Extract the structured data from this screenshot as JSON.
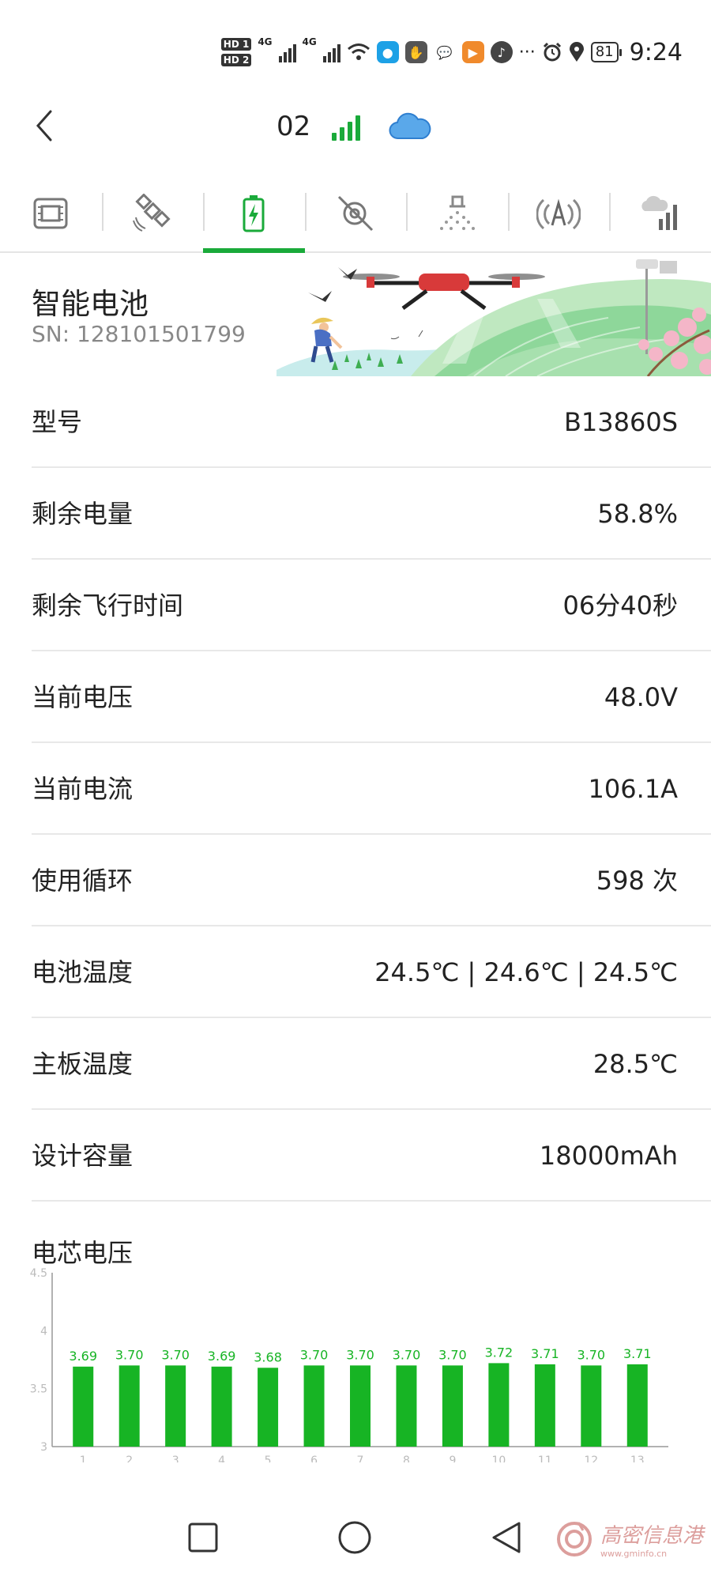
{
  "status_bar": {
    "hd1": "HD 1",
    "hd2": "HD 2",
    "net1": "4G",
    "net2": "4G",
    "more": "···",
    "battery": "81",
    "time": "9:24"
  },
  "header": {
    "drone_id": "02",
    "accent_color": "#1aaa3a",
    "cloud_color": "#3a8fe0"
  },
  "tabs": [
    {
      "icon": "flight-controller-icon",
      "active": false
    },
    {
      "icon": "satellite-icon",
      "active": false
    },
    {
      "icon": "battery-icon",
      "active": true
    },
    {
      "icon": "radar-icon",
      "active": false
    },
    {
      "icon": "spray-icon",
      "active": false
    },
    {
      "icon": "antenna-icon",
      "active": false
    },
    {
      "icon": "weather-signal-icon",
      "active": false
    }
  ],
  "banner": {
    "title": "智能电池",
    "sn": "SN: 128101501799"
  },
  "rows": [
    {
      "label": "型号",
      "value": "B13860S"
    },
    {
      "label": "剩余电量",
      "value": "58.8%"
    },
    {
      "label": "剩余飞行时间",
      "value": "06分40秒"
    },
    {
      "label": "当前电压",
      "value": "48.0V"
    },
    {
      "label": "当前电流",
      "value": "106.1A"
    },
    {
      "label": "使用循环",
      "value": "598 次"
    },
    {
      "label": "电池温度",
      "value": "24.5℃ | 24.6℃ | 24.5℃"
    },
    {
      "label": "主板温度",
      "value": "28.5℃"
    },
    {
      "label": "设计容量",
      "value": "18000mAh"
    }
  ],
  "chart_title": "电芯电压",
  "chart_data": {
    "type": "bar",
    "title": "电芯电压",
    "categories": [
      "1",
      "2",
      "3",
      "4",
      "5",
      "6",
      "7",
      "8",
      "9",
      "10",
      "11",
      "12",
      "13"
    ],
    "values": [
      3.69,
      3.7,
      3.7,
      3.69,
      3.68,
      3.7,
      3.7,
      3.7,
      3.7,
      3.72,
      3.71,
      3.7,
      3.71
    ],
    "value_labels": [
      "3.69",
      "3.70",
      "3.70",
      "3.69",
      "3.68",
      "3.70",
      "3.70",
      "3.70",
      "3.70",
      "3.72",
      "3.71",
      "3.70",
      "3.71"
    ],
    "ylim": [
      3,
      4.5
    ],
    "yticks": [
      "3",
      "3.5",
      "4",
      "4.5"
    ],
    "bar_color": "#17b424",
    "grid": false
  },
  "watermark": {
    "text": "高密信息港",
    "url": "www.gminfo.cn"
  }
}
